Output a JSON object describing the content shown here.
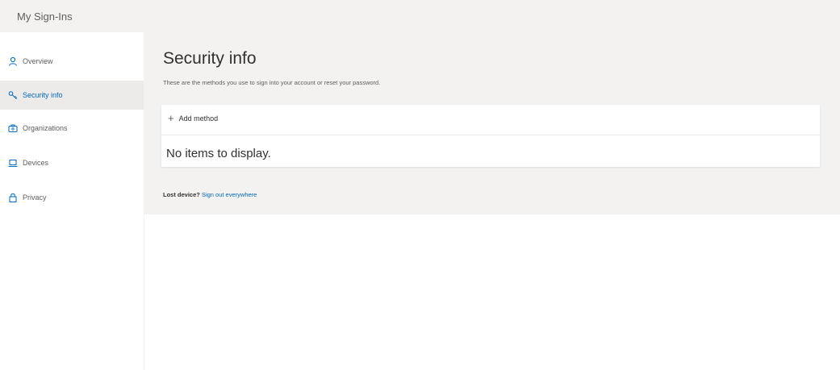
{
  "app": {
    "title": "My Sign-Ins"
  },
  "sidebar": {
    "items": [
      {
        "label": "Overview",
        "icon": "person-icon",
        "active": false
      },
      {
        "label": "Security info",
        "icon": "key-icon",
        "active": true
      },
      {
        "label": "Organizations",
        "icon": "briefcase-icon",
        "active": false
      },
      {
        "label": "Devices",
        "icon": "laptop-icon",
        "active": false
      },
      {
        "label": "Privacy",
        "icon": "lock-icon",
        "active": false
      }
    ]
  },
  "main": {
    "title": "Security info",
    "subtitle": "These are the methods you use to sign into your account or reset your password.",
    "add_method_label": "Add method",
    "empty_message": "No items to display.",
    "lost_device_label": "Lost device?",
    "sign_out_link": "Sign out everywhere"
  },
  "colors": {
    "accent": "#0067b8",
    "topbar_bg": "#f3f2f1",
    "active_nav_bg": "#edebe9"
  }
}
